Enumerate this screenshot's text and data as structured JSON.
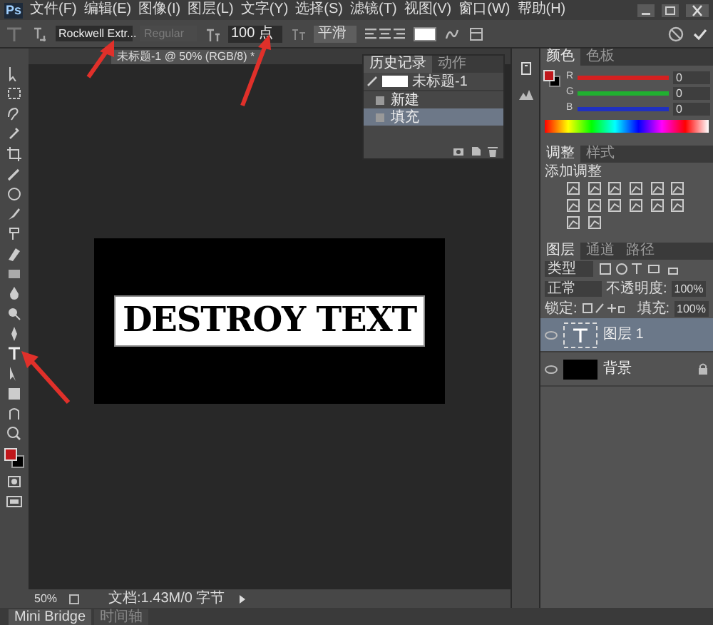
{
  "app": {
    "logo": "Ps"
  },
  "menu": [
    "文件(F)",
    "编辑(E)",
    "图像(I)",
    "图层(L)",
    "文字(Y)",
    "选择(S)",
    "滤镜(T)",
    "视图(V)",
    "窗口(W)",
    "帮助(H)"
  ],
  "options": {
    "font_family": "Rockwell Extr...",
    "font_style": "Regular",
    "font_style_disabled": true,
    "font_size": "100 点",
    "antialias": "平滑"
  },
  "document_tab": "未标题-1 @ 50% (RGB/8) *",
  "canvas": {
    "text": "DESTROY TEXT"
  },
  "history": {
    "tabs": [
      {
        "label": "历史记录",
        "selected": true
      },
      {
        "label": "动作",
        "selected": false
      }
    ],
    "snapshot": "未标题-1",
    "items": [
      {
        "label": "新建",
        "selected": false
      },
      {
        "label": "填充",
        "selected": true
      }
    ]
  },
  "color": {
    "tabs": [
      {
        "label": "颜色",
        "selected": true
      },
      {
        "label": "色板",
        "selected": false
      }
    ],
    "channels": [
      {
        "label": "R",
        "value": "0",
        "color": "#d42020"
      },
      {
        "label": "G",
        "value": "0",
        "color": "#20b030"
      },
      {
        "label": "B",
        "value": "0",
        "color": "#2030c0"
      }
    ]
  },
  "adjustments": {
    "tabs": [
      {
        "label": "调整",
        "selected": true
      },
      {
        "label": "样式",
        "selected": false
      }
    ],
    "heading": "添加调整"
  },
  "layers": {
    "tabs": [
      {
        "label": "图层",
        "selected": true
      },
      {
        "label": "通道",
        "selected": false
      },
      {
        "label": "路径",
        "selected": false
      }
    ],
    "filter": "类型",
    "blend": "正常",
    "opacity_label": "不透明度:",
    "opacity": "100%",
    "lock_label": "锁定:",
    "fill_label": "填充:",
    "fill": "100%",
    "items": [
      {
        "name": "图层 1",
        "kind": "text",
        "selected": true,
        "locked": false
      },
      {
        "name": "背景",
        "kind": "fill",
        "selected": false,
        "locked": true
      }
    ]
  },
  "status": {
    "zoom": "50%",
    "document": "文档:1.43M/0 字节"
  },
  "bottom_tabs": [
    {
      "label": "Mini Bridge",
      "selected": true
    },
    {
      "label": "时间轴",
      "selected": false
    }
  ]
}
